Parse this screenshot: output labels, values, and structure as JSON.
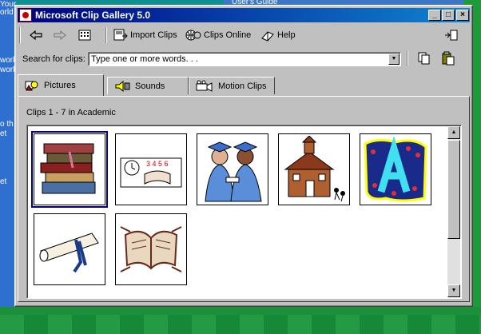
{
  "window": {
    "title": "Microsoft Clip Gallery 5.0"
  },
  "title_buttons": {
    "minimize": "_",
    "maximize": "□",
    "close": "×"
  },
  "toolbar": {
    "import_label": "Import Clips",
    "online_label": "Clips Online",
    "help_label": "Help"
  },
  "search": {
    "label": "Search for clips:",
    "placeholder": "Type one or more words. . ."
  },
  "tabs": [
    {
      "label": "Pictures",
      "active": true
    },
    {
      "label": "Sounds",
      "active": false
    },
    {
      "label": "Motion Clips",
      "active": false
    }
  ],
  "status": {
    "clip_count": "Clips 1 - 7 in Academic"
  },
  "desktop": {
    "left_labels": [
      "Your",
      "orld",
      "work",
      "work",
      "o th",
      "et",
      "et"
    ],
    "top_label": "User's Guide"
  },
  "clips": [
    {
      "name": "books-clip"
    },
    {
      "name": "math-book-clip"
    },
    {
      "name": "graduates-clip"
    },
    {
      "name": "schoolhouse-clip"
    },
    {
      "name": "letter-a-clip"
    },
    {
      "name": "diploma-clip"
    },
    {
      "name": "open-book-clip"
    }
  ]
}
